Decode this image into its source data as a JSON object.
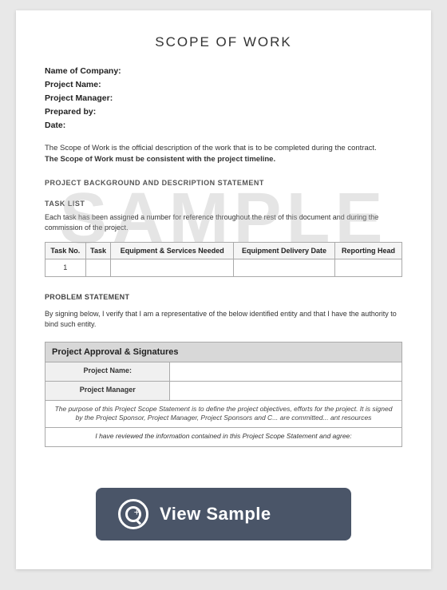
{
  "page": {
    "title": "SCOPE OF WORK",
    "fields": [
      {
        "label": "Name of Company:"
      },
      {
        "label": "Project Name:"
      },
      {
        "label": "Project Manager:"
      },
      {
        "label": "Prepared by:"
      },
      {
        "label": "Date:"
      }
    ],
    "description": "The Scope of Work is the official description of the work that is to be completed during the contract.",
    "description_bold": "The Scope of Work must be consistent with the project timeline.",
    "watermark": "SAMPLE",
    "sections": [
      {
        "heading": "PROJECT BACKGROUND AND DESCRIPTION STATEMENT"
      },
      {
        "heading": "TASK LIST",
        "body": "Each task has been assigned a number for reference throughout the rest of this document and during the commission of the project."
      }
    ],
    "table": {
      "headers": [
        "Task No.",
        "Task",
        "Equipment & Services Needed",
        "Equipment Delivery Date",
        "Reporting Head"
      ],
      "rows": [
        [
          "1",
          "",
          "",
          "",
          ""
        ]
      ]
    },
    "problem": {
      "heading": "PROBLEM STATEMENT",
      "text": "By signing below, I verify that I am a representative of the below identified entity and that I have the authority to bind such entity."
    },
    "approval": {
      "title": "Project Approval & Signatures",
      "rows": [
        {
          "label": "Project Name:",
          "value": ""
        },
        {
          "label": "Project Manager",
          "value": ""
        }
      ],
      "purpose_text": "The purpose of this Project Scope Statement is to define the project objectives, efforts for the project. It is signed by the Project Sponsor, Project Manager, Project Sponsors and C... are committed... ant resources",
      "last_line": "I have reviewed the information contained in this Project Scope Statement and agree:"
    },
    "view_sample": {
      "label": "View Sample"
    }
  }
}
